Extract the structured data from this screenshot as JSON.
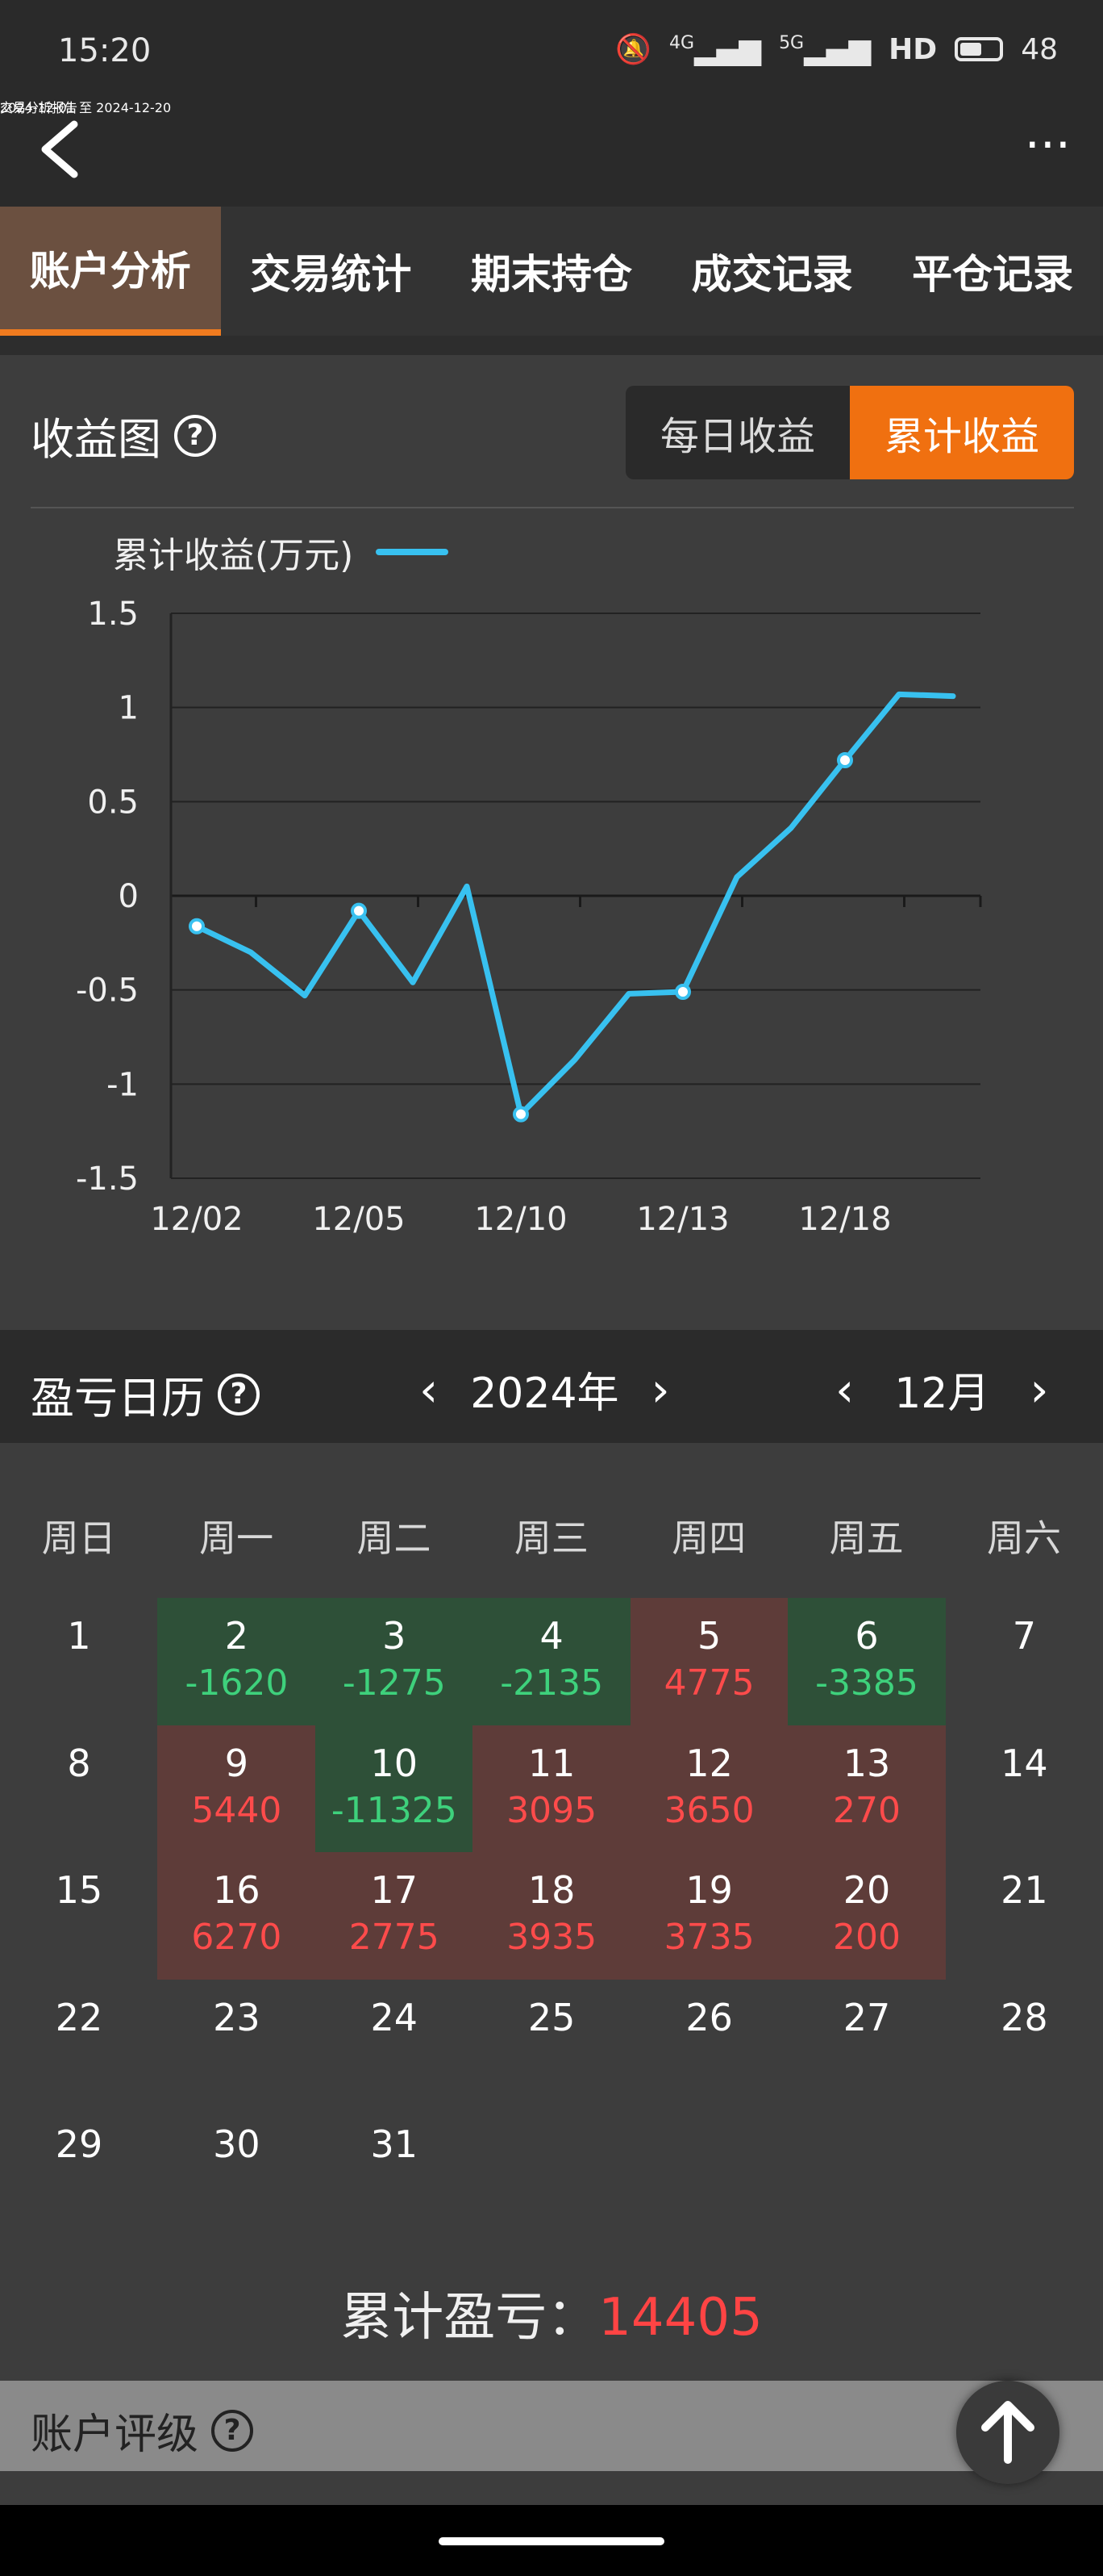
{
  "status": {
    "time": "15:20",
    "signal1": "4G",
    "signal2": "5G",
    "hd": "HD",
    "battery": "48"
  },
  "header": {
    "title": "交易分析报告",
    "range": "2024-12-01  至  2024-12-20"
  },
  "tabs": [
    {
      "label": "账户分析",
      "active": true
    },
    {
      "label": "交易统计",
      "active": false
    },
    {
      "label": "期末持仓",
      "active": false
    },
    {
      "label": "成交记录",
      "active": false
    },
    {
      "label": "平仓记录",
      "active": false
    }
  ],
  "income": {
    "title": "收益图",
    "help": "?",
    "toggle": {
      "daily": "每日收益",
      "cumulative": "累计收益"
    }
  },
  "chart_data": {
    "type": "line",
    "x": [
      "12/02",
      "12/03",
      "12/04",
      "12/05",
      "12/06",
      "12/09",
      "12/10",
      "12/11",
      "12/12",
      "12/13",
      "12/16",
      "12/17",
      "12/18",
      "12/19",
      "12/20"
    ],
    "series": [
      {
        "name": "累计收益(万元)",
        "values": [
          -0.162,
          -0.3,
          -0.53,
          -0.08,
          -0.46,
          0.05,
          -1.16,
          -0.87,
          -0.52,
          -0.51,
          0.1,
          0.36,
          0.72,
          1.07,
          1.06
        ]
      }
    ],
    "markers": [
      0,
      3,
      6,
      9,
      12
    ],
    "ylim": [
      -1.5,
      1.5
    ],
    "yticks": [
      "1.5",
      "1",
      "0.5",
      "0",
      "-0.5",
      "-1",
      "-1.5"
    ],
    "xticks": [
      "12/02",
      "12/05",
      "12/10",
      "12/13",
      "12/18"
    ],
    "xtick_index": [
      0,
      3,
      6,
      9,
      12
    ],
    "grid": true,
    "line_color": "#38c1f0"
  },
  "calendar": {
    "title": "盈亏日历",
    "help": "?",
    "year": "2024年",
    "month": "12月",
    "weekdays": [
      "周日",
      "周一",
      "周二",
      "周三",
      "周四",
      "周五",
      "周六"
    ],
    "weeks": [
      [
        {
          "d": "1",
          "v": "",
          "t": ""
        },
        {
          "d": "2",
          "v": "-1620",
          "t": "loss"
        },
        {
          "d": "3",
          "v": "-1275",
          "t": "loss"
        },
        {
          "d": "4",
          "v": "-2135",
          "t": "loss"
        },
        {
          "d": "5",
          "v": "4775",
          "t": "gain"
        },
        {
          "d": "6",
          "v": "-3385",
          "t": "loss"
        },
        {
          "d": "7",
          "v": "",
          "t": ""
        }
      ],
      [
        {
          "d": "8",
          "v": "",
          "t": ""
        },
        {
          "d": "9",
          "v": "5440",
          "t": "gain"
        },
        {
          "d": "10",
          "v": "-11325",
          "t": "loss"
        },
        {
          "d": "11",
          "v": "3095",
          "t": "gain"
        },
        {
          "d": "12",
          "v": "3650",
          "t": "gain"
        },
        {
          "d": "13",
          "v": "270",
          "t": "gain"
        },
        {
          "d": "14",
          "v": "",
          "t": ""
        }
      ],
      [
        {
          "d": "15",
          "v": "",
          "t": ""
        },
        {
          "d": "16",
          "v": "6270",
          "t": "gain"
        },
        {
          "d": "17",
          "v": "2775",
          "t": "gain"
        },
        {
          "d": "18",
          "v": "3935",
          "t": "gain"
        },
        {
          "d": "19",
          "v": "3735",
          "t": "gain"
        },
        {
          "d": "20",
          "v": "200",
          "t": "gain"
        },
        {
          "d": "21",
          "v": "",
          "t": ""
        }
      ],
      [
        {
          "d": "22",
          "v": "",
          "t": ""
        },
        {
          "d": "23",
          "v": "",
          "t": ""
        },
        {
          "d": "24",
          "v": "",
          "t": ""
        },
        {
          "d": "25",
          "v": "",
          "t": ""
        },
        {
          "d": "26",
          "v": "",
          "t": ""
        },
        {
          "d": "27",
          "v": "",
          "t": ""
        },
        {
          "d": "28",
          "v": "",
          "t": ""
        }
      ],
      [
        {
          "d": "29",
          "v": "",
          "t": ""
        },
        {
          "d": "30",
          "v": "",
          "t": ""
        },
        {
          "d": "31",
          "v": "",
          "t": ""
        }
      ]
    ],
    "total_label": "累计盈亏：",
    "total_value": "14405"
  },
  "rating": {
    "title": "账户评级",
    "help": "?"
  },
  "colors": {
    "accent": "#f07010",
    "gain": "#ff4b4b",
    "loss": "#3ed17c"
  }
}
